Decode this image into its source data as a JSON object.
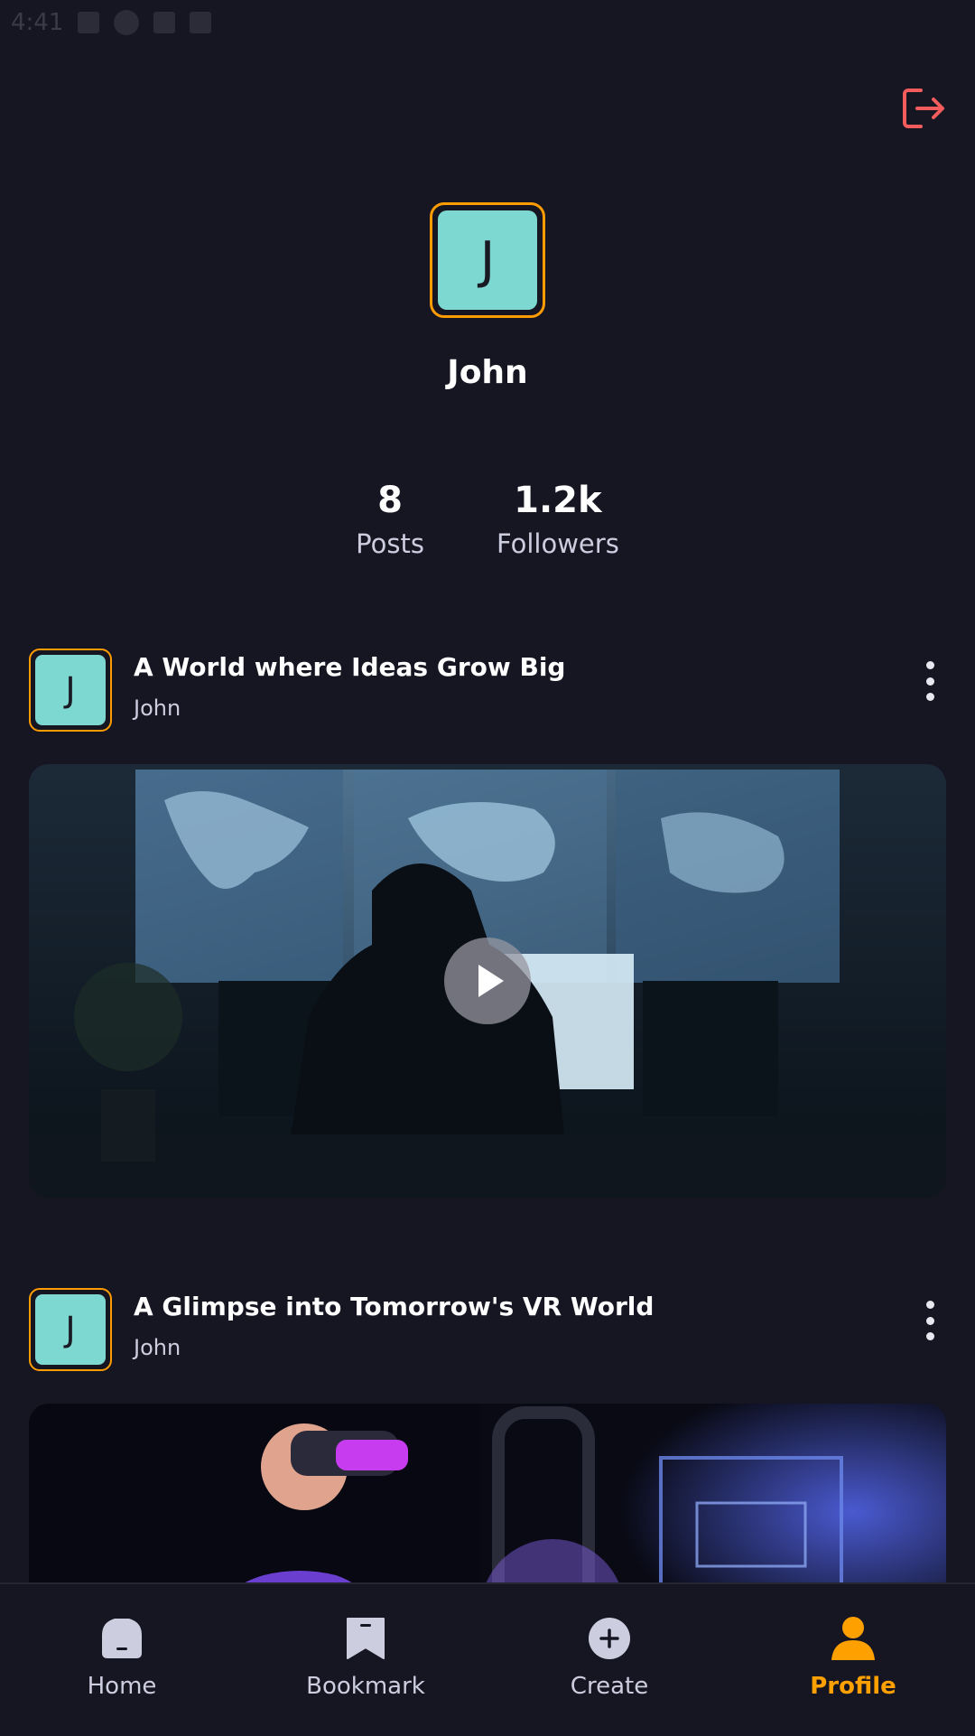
{
  "status_bar": {
    "time": "4:41"
  },
  "header": {
    "logout_icon": "logout-icon",
    "logout_color": "#F25C5C"
  },
  "profile": {
    "avatar_initial": "J",
    "name": "John",
    "stats": [
      {
        "value": "8",
        "label": "Posts"
      },
      {
        "value": "1.2k",
        "label": "Followers"
      }
    ]
  },
  "posts": [
    {
      "title": "A World where Ideas Grow Big",
      "author": "John",
      "avatar_initial": "J"
    },
    {
      "title": "A Glimpse into Tomorrow's VR World",
      "author": "John",
      "avatar_initial": "J"
    }
  ],
  "tabbar": {
    "tabs": [
      {
        "label": "Home",
        "icon": "home-icon"
      },
      {
        "label": "Bookmark",
        "icon": "bookmark-icon"
      },
      {
        "label": "Create",
        "icon": "plus-circle-icon"
      },
      {
        "label": "Profile",
        "icon": "profile-icon"
      }
    ],
    "active": "Profile"
  },
  "colors": {
    "background": "#161622",
    "accent": "#FF9C01",
    "avatar_bg": "#7DD8D2",
    "inactive": "#CDCDE0"
  }
}
